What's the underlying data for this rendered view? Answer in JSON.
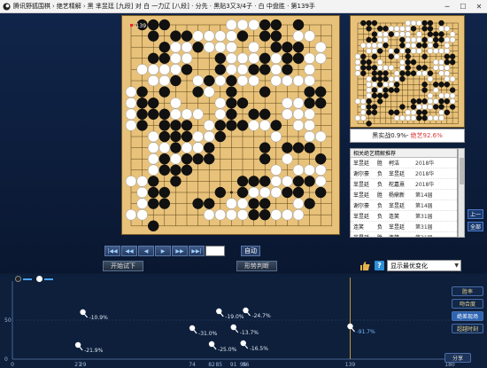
{
  "titlebar": {
    "app_name": "腾讯野狐围棋",
    "section": "绝艺精解",
    "game_info": "黑 芈昱廷 [九段] 对 白 一力辽 [八段] · 分先 · 黑贴3又3/4子 · 白 中盘胜 · 第139手"
  },
  "board": {
    "move_number_label": "139",
    "size": 19,
    "black": [
      "c1",
      "c3",
      "d3",
      "c4",
      "d4",
      "c5",
      "e5",
      "d6",
      "e6",
      "f6",
      "d7",
      "f7",
      "g7",
      "h7",
      "e8",
      "h8",
      "d9",
      "e9",
      "f9",
      "j9",
      "b10",
      "d10",
      "e10",
      "f10",
      "j10",
      "k10",
      "l10",
      "b11",
      "c11",
      "d11",
      "k11",
      "b12",
      "c12",
      "k12",
      "l12",
      "b13",
      "d13",
      "g13",
      "k13",
      "n13",
      "e14",
      "h14",
      "k14",
      "f15",
      "j15",
      "m15",
      "n15",
      "p15",
      "c16",
      "d16",
      "j16",
      "n16",
      "p16",
      "q16",
      "d17",
      "g17",
      "o17",
      "p17",
      "q17",
      "c18",
      "e18",
      "f18",
      "l18",
      "n18",
      "o18",
      "b19",
      "c19",
      "d19",
      "n19",
      "o19",
      "q19",
      "g3",
      "h3",
      "j4",
      "l4",
      "l5",
      "m5",
      "n5",
      "p4",
      "q4",
      "q5",
      "r5",
      "s4",
      "r3",
      "m3",
      "n3",
      "m2",
      "n2",
      "n7",
      "n8",
      "p8",
      "q8",
      "r8",
      "s7",
      "r12",
      "s12",
      "r13",
      "s13",
      "n11",
      "m11",
      "o10"
    ],
    "white": [
      "a2",
      "b2",
      "b3",
      "b4",
      "a5",
      "b5",
      "c6",
      "c7",
      "c8",
      "c9",
      "a10",
      "a11",
      "a12",
      "a13",
      "c14",
      "d14",
      "b15",
      "c15",
      "d15",
      "e15",
      "e16",
      "f16",
      "e17",
      "f17",
      "g18",
      "h18",
      "h17",
      "j17",
      "k17",
      "j18",
      "k18",
      "k19",
      "l19",
      "m19",
      "m17",
      "m16",
      "l16",
      "k16",
      "l15",
      "k15",
      "j14",
      "m14",
      "l14",
      "o14",
      "p14",
      "q14",
      "r14",
      "r15",
      "r16",
      "o15",
      "o16",
      "s16",
      "s17",
      "r18",
      "q18",
      "d8",
      "e7",
      "g8",
      "f8",
      "g9",
      "h9",
      "h10",
      "g11",
      "f11",
      "e11",
      "e12",
      "g14",
      "h13",
      "j12",
      "j11",
      "m10",
      "n10",
      "p11",
      "p12",
      "q12",
      "q11",
      "q10",
      "r10",
      "r11",
      "r9",
      "s9",
      "q6",
      "r6",
      "s6",
      "s5",
      "p5",
      "o6",
      "o5",
      "o4",
      "n4",
      "m4",
      "l3",
      "k3",
      "k2",
      "l2",
      "j2",
      "h2",
      "o2",
      "p2",
      "q2",
      "q3",
      "p7",
      "o9"
    ]
  },
  "winrate_bar": {
    "black_label": "黑实战0.9%",
    "dash": " - ",
    "ai_label": "绝艺92.6%"
  },
  "recommend": {
    "header": "相关绝艺精解推荐",
    "rows": [
      {
        "player": "芈昱廷",
        "result": "胜",
        "opponent": "柯洁",
        "event": "2018华"
      },
      {
        "player": "谢尔豪",
        "result": "负",
        "opponent": "芈昱廷",
        "event": "2018华"
      },
      {
        "player": "芈昱廷",
        "result": "负",
        "opponent": "柁嘉熹",
        "event": "2018华"
      },
      {
        "player": "芈昱廷",
        "result": "胜",
        "opponent": "杨鼎新",
        "event": "第14届"
      },
      {
        "player": "谢尔豪",
        "result": "负",
        "opponent": "芈昱廷",
        "event": "第14届"
      },
      {
        "player": "芈昱廷",
        "result": "负",
        "opponent": "连笑",
        "event": "第31届"
      },
      {
        "player": "连笑",
        "result": "负",
        "opponent": "芈昱廷",
        "event": "第31届"
      },
      {
        "player": "芈昱廷",
        "result": "胜",
        "opponent": "连笑",
        "event": "第31届"
      }
    ]
  },
  "side_buttons": {
    "top": "上一",
    "bottom": "全部"
  },
  "controls": {
    "buttons": [
      "|◀◀",
      "◀◀",
      "◀",
      "▶",
      "▶▶",
      "▶▶|",
      ""
    ],
    "auto_label": "自动",
    "trial_label": "开始试下",
    "judge_label": "形势判断",
    "select_value": "显示最优变化"
  },
  "chart_data": {
    "type": "scatter",
    "title": "",
    "y_ticks": [
      "50",
      "0"
    ],
    "x_ticks": [
      "0",
      "27",
      "29",
      "74",
      "82",
      "85",
      "91",
      "95",
      "96",
      "139",
      "180"
    ],
    "ylim": [
      0,
      100
    ],
    "x_max": 180,
    "current_move": 139,
    "points": [
      {
        "move": 27,
        "label": "-21.9%"
      },
      {
        "move": 29,
        "label": "-10.9%"
      },
      {
        "move": 74,
        "label": "-31.0%"
      },
      {
        "move": 82,
        "label": "-25.0%"
      },
      {
        "move": 85,
        "label": "-19.0%"
      },
      {
        "move": 91,
        "label": "-13.7%"
      },
      {
        "move": 95,
        "label": "-16.5%"
      },
      {
        "move": 96,
        "label": "-24.7%"
      },
      {
        "move": 139,
        "label": "-91.7%"
      }
    ]
  },
  "right_buttons": [
    "胜率",
    "吻合度",
    "绝差现场",
    "超越时刻"
  ],
  "share_label": "分享"
}
